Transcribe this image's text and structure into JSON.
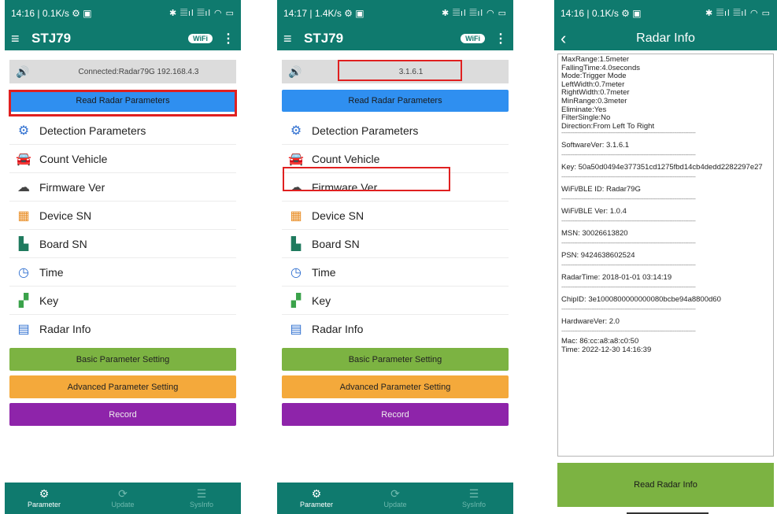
{
  "common": {
    "app_title": "STJ79",
    "wifi_badge": "WiFi",
    "status_icons": "✱ 𝄚ıl 𝄚ıl ◠ ▭"
  },
  "screen1": {
    "status_left": "14:16 | 0.1K/s ⚙ ▣",
    "conn_text": "Connected:Radar79G 192.168.4.3",
    "read_params": "Read Radar Parameters",
    "menu": [
      {
        "icon": "gear-icon",
        "label": "Detection Parameters"
      },
      {
        "icon": "car-icon",
        "label": "Count Vehicle"
      },
      {
        "icon": "cloud-icon",
        "label": "Firmware Ver"
      },
      {
        "icon": "qrcode-icon",
        "label": "Device SN"
      },
      {
        "icon": "board-icon",
        "label": "Board SN"
      },
      {
        "icon": "clock-icon",
        "label": "Time"
      },
      {
        "icon": "key-icon",
        "label": "Key"
      },
      {
        "icon": "chat-icon",
        "label": "Radar Info"
      }
    ],
    "basic": "Basic Parameter Setting",
    "advanced": "Advanced Parameter Setting",
    "record": "Record",
    "nav": [
      "Parameter",
      "Update",
      "SysInfo"
    ]
  },
  "screen2": {
    "status_left": "14:17 | 1.4K/s ⚙ ▣",
    "conn_text": "3.1.6.1",
    "read_params": "Read Radar Parameters",
    "menu": [
      {
        "icon": "gear-icon",
        "label": "Detection Parameters"
      },
      {
        "icon": "car-icon",
        "label": "Count Vehicle"
      },
      {
        "icon": "cloud-icon",
        "label": "Firmware Ver"
      },
      {
        "icon": "qrcode-icon",
        "label": "Device SN"
      },
      {
        "icon": "board-icon",
        "label": "Board SN"
      },
      {
        "icon": "clock-icon",
        "label": "Time"
      },
      {
        "icon": "key-icon",
        "label": "Key"
      },
      {
        "icon": "chat-icon",
        "label": "Radar Info"
      }
    ],
    "basic": "Basic Parameter Setting",
    "advanced": "Advanced Parameter Setting",
    "record": "Record",
    "nav": [
      "Parameter",
      "Update",
      "SysInfo"
    ]
  },
  "screen3": {
    "status_left": "14:16 | 0.1K/s ⚙ ▣",
    "title": "Radar Info",
    "params": [
      "MaxRange:1.5meter",
      "FallingTime:4.0seconds",
      "Mode:Trigger Mode",
      "LeftWidth:0.7meter",
      "RightWidth:0.7meter",
      "MinRange:0.3meter",
      "Eliminate:Yes",
      "FilterSingle:No",
      "Direction:From Left To Right"
    ],
    "fields": [
      "SoftwareVer: 3.1.6.1",
      "Key: 50a50d0494e377351cd1275fbd14cb4dedd2282297e27",
      "WiFi/BLE ID: Radar79G",
      "WiFi/BLE Ver: 1.0.4",
      "MSN: 30026613820",
      "PSN: 9424638602524",
      "RadarTime: 2018-01-01 03:14:19",
      "ChipID: 3e1000800000000080bcbe94a8800d60",
      "HardwareVer: 2.0"
    ],
    "mac": "Mac: 86:cc:a8:a8:c0:50",
    "time": "Time: 2022-12-30 14:16:39",
    "separator": "---------------------------------------------------------------------------------------------",
    "read_info": "Read Radar Info"
  },
  "colors": {
    "teal": "#0f7a6e",
    "blue": "#2f8ff0",
    "green": "#7cb342",
    "orange": "#f4a93b",
    "purple": "#8e24aa",
    "highlight": "#e02020"
  }
}
